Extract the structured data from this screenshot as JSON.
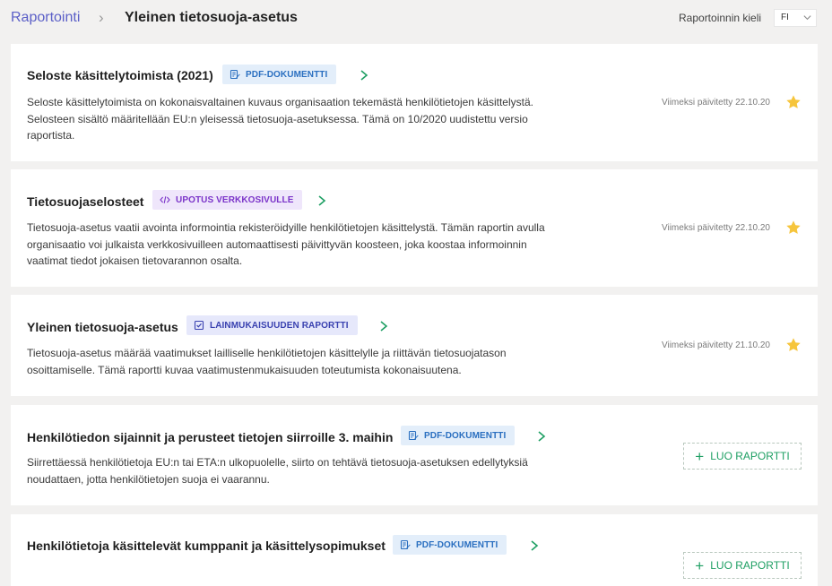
{
  "header": {
    "breadcrumb_root": "Raportointi",
    "breadcrumb_separator": "›",
    "title": "Yleinen tietosuoja-asetus",
    "language_label": "Raportoinnin kieli",
    "language_value": "FI"
  },
  "cards": [
    {
      "title": "Seloste käsittelytoimista (2021)",
      "tag": "PDF-DOKUMENTTI",
      "tag_icon": "document-edit-icon",
      "description": "Seloste käsittelytoimista on kokonaisvaltainen kuvaus organisaation tekemästä henkilötietojen käsittelystä. Selosteen sisältö määritellään EU:n yleisessä tietosuoja-asetuksessa. Tämä on 10/2020 uudistettu versio raportista.",
      "updated": "Viimeksi päivitetty 22.10.20",
      "starred": true
    },
    {
      "title": "Tietosuojaselosteet",
      "tag": "UPOTUS VERKKOSIVULLE",
      "tag_icon": "code-icon",
      "description": "Tietosuoja-asetus vaatii avointa informointia rekisteröidyille henkilötietojen käsittelystä. Tämän raportin avulla organisaatio voi julkaista verkkosivuilleen automaattisesti päivittyvän koosteen, joka koostaa informoinnin vaatimat tiedot jokaisen tietovarannon osalta.",
      "updated": "Viimeksi päivitetty 22.10.20",
      "starred": true
    },
    {
      "title": "Yleinen tietosuoja-asetus",
      "tag": "LAINMUKAISUUDEN RAPORTTI",
      "tag_icon": "checkbox-icon",
      "description": "Tietosuoja-asetus määrää vaatimukset lailliselle henkilötietojen käsittelylle ja riittävän tietosuojatason osoittamiselle. Tämä raportti kuvaa vaatimustenmukaisuuden toteutumista kokonaisuutena.",
      "updated": "Viimeksi päivitetty 21.10.20",
      "starred": true
    },
    {
      "title": "Henkilötiedon sijainnit ja perusteet tietojen siirroille 3. maihin",
      "tag": "PDF-DOKUMENTTI",
      "tag_icon": "document-edit-icon",
      "description": "Siirrettäessä henkilötietoja EU:n tai ETA:n ulkopuolelle, siirto on tehtävä tietosuoja-asetuksen edellytyksiä noudattaen, jotta henkilötietojen suoja ei vaarannu.",
      "action": "LUO RAPORTTI"
    },
    {
      "title": "Henkilötietoja käsittelevät kumppanit ja käsittelysopimukset",
      "tag": "PDF-DOKUMENTTI",
      "tag_icon": "document-edit-icon",
      "description": "",
      "action": "LUO RAPORTTI"
    }
  ],
  "colors": {
    "accent_purple": "#5b5fc7",
    "arrow_green": "#1e9f63",
    "star_gold": "#f6c53c",
    "pdf_tag_bg": "#e3eefa",
    "embed_tag_bg": "#efe6fb",
    "compliance_tag_bg": "#e6e8fb"
  }
}
